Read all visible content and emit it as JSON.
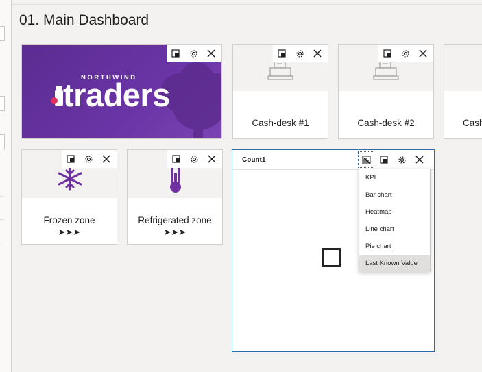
{
  "page": {
    "title": "01. Main Dashboard"
  },
  "colors": {
    "brand_purple": "#6a34a6",
    "icon_purple": "#7030a0",
    "selection_blue": "#2b6cb0"
  },
  "tile_actions": {
    "pin_icon": "pin-to-dashboard-icon",
    "settings_icon": "gear-icon",
    "close_icon": "close-icon"
  },
  "banner": {
    "brand_small": "NORTHWIND",
    "brand_big": "traders"
  },
  "tiles": [
    {
      "label": "Cash-desk #1",
      "icon": "cash-register-icon"
    },
    {
      "label": "Cash-desk #2",
      "icon": "cash-register-icon"
    },
    {
      "label": "Cash",
      "icon": "cash-register-icon"
    },
    {
      "label": "Frozen zone",
      "icon": "snowflake-icon",
      "arrows": "➤➤➤"
    },
    {
      "label": "Refrigerated zone",
      "icon": "thermometer-icon",
      "arrows": "➤➤➤"
    }
  ],
  "count_tile": {
    "title": "Count1",
    "visual_type_icon": "visualization-type-icon"
  },
  "visual_menu": {
    "items": [
      "KPI",
      "Bar chart",
      "Heatmap",
      "Line chart",
      "Pie chart",
      "Last Known Value"
    ],
    "highlighted": "Last Known Value"
  }
}
